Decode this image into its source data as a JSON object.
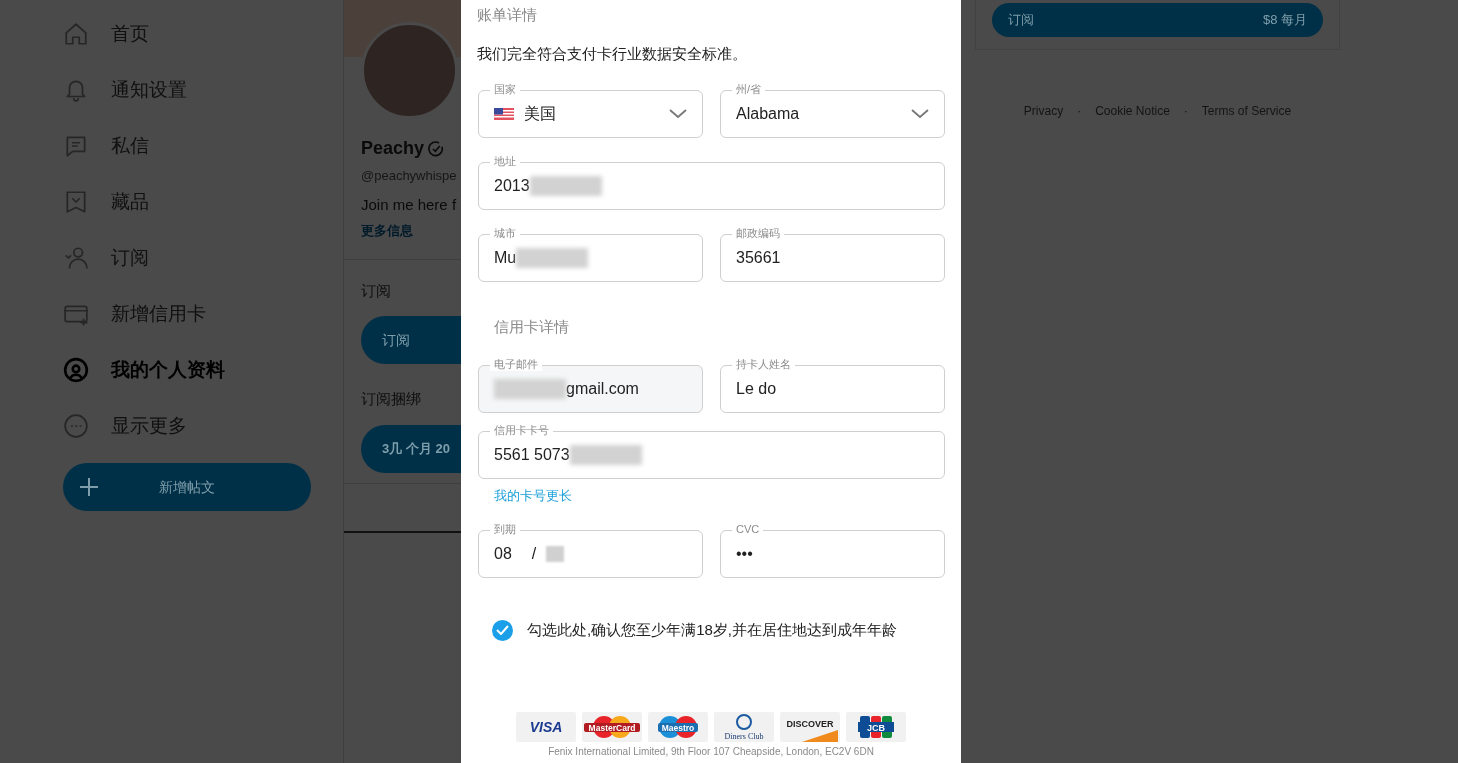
{
  "sidebar": {
    "items": [
      {
        "label": "首页",
        "selected": false
      },
      {
        "label": "通知设置",
        "selected": false
      },
      {
        "label": "私信",
        "selected": false
      },
      {
        "label": "藏品",
        "selected": false
      },
      {
        "label": "订阅",
        "selected": false
      },
      {
        "label": "新增信用卡",
        "selected": false
      },
      {
        "label": "我的个人资料",
        "selected": true
      },
      {
        "label": "显示更多",
        "selected": false
      }
    ],
    "new_post_button": "新增帖文"
  },
  "profile": {
    "name": "Peachy",
    "verified": true,
    "handle": "@peachywhispe",
    "bio": "Join me here f",
    "more_link": "更多信息",
    "subscription_heading": "订阅",
    "subscribe_button": "订阅",
    "bundles_heading": "订阅捆绑",
    "bundle_button": "3几 个月 20"
  },
  "right_panel": {
    "subscribe_button": {
      "label": "订阅",
      "price": "$8 每月"
    },
    "footer_links": [
      "Privacy",
      "Cookie Notice",
      "Terms of Service"
    ],
    "footer_separator": "·"
  },
  "modal": {
    "section_title": "账单详情",
    "compliance_text": "我们完全符合支付卡行业数据安全标准。",
    "billing_fields": [
      {
        "label": "国家",
        "value": "美国",
        "kind": "country"
      },
      {
        "label": "州/省",
        "value": "Alabama",
        "kind": "select"
      },
      {
        "label": "地址",
        "value": "2013",
        "kind": "wide",
        "redacted": true
      },
      {
        "label": "城市",
        "value": "Mu",
        "kind": "text",
        "redacted": true
      },
      {
        "label": "邮政编码",
        "value": "35661",
        "kind": "text"
      }
    ],
    "card_section_title": "信用卡详情",
    "card_fields": [
      {
        "label": "电子邮件",
        "value": "gmail.com",
        "kind": "text",
        "disabled": true,
        "redacted": true
      },
      {
        "label": "持卡人姓名",
        "value": "Le do",
        "kind": "text"
      },
      {
        "label": "信用卡卡号",
        "value": "5561 5073",
        "kind": "wide",
        "redacted": true
      }
    ],
    "longer_card_link": "我的卡号更长",
    "expiry": {
      "label": "到期",
      "month": "08",
      "separator": "/"
    },
    "cvc": {
      "label": "CVC",
      "value": "•••"
    },
    "age_confirm": {
      "label": "勾选此处,确认您至少年满18岁,并在居住地达到成年年龄",
      "checked": true
    },
    "card_brands": [
      "VISA",
      "MasterCard",
      "Maestro",
      "Diners Club",
      "DISCOVER",
      "JCB"
    ],
    "footer_address": "Fenix International Limited, 9th Floor 107 Cheapside, London, EC2V 6DN"
  }
}
